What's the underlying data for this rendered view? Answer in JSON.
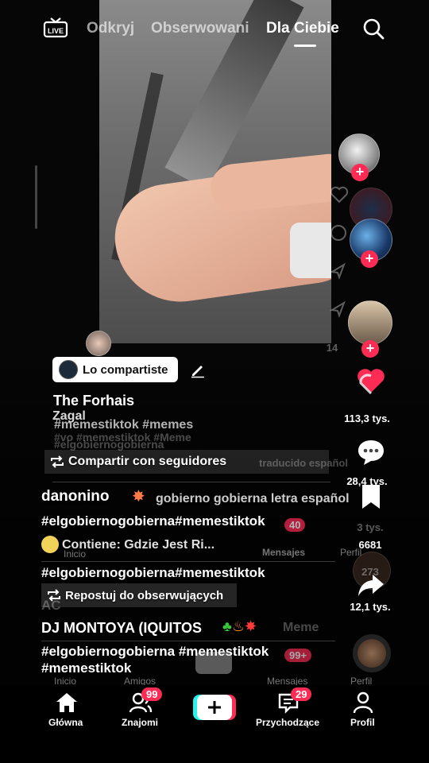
{
  "top_nav": {
    "live_label": "LIVE",
    "tabs": [
      {
        "label": "Odkryj",
        "active": false
      },
      {
        "label": "Obserwowani",
        "active": false
      },
      {
        "label": "Dla Ciebie",
        "active": true
      }
    ]
  },
  "overlay": {
    "shared_label": "Lo compartiste",
    "music_line": "The Forhais",
    "music_sub": "Zagal",
    "hashtags_1": "#memestiktok #memes",
    "ghost_hashtags": "#vo #memestiktok #Meme",
    "ghost_hashtag_2": "#elgobiernogobierna",
    "share_followers": "Compartir con seguidores",
    "ghost_translation": "traducido español",
    "username_1": "danonino",
    "caption_1": "gobierno gobierna letra español",
    "hashtags_2": "#elgobiernogobierna#memestiktok",
    "contains": "Contiene: Gdzie Jest Ri...",
    "ghost_inicio": "Inicio",
    "ghost_amigos": "Amigos",
    "ghost_mensajes": "Mensajes",
    "ghost_mensajes_badge": "40",
    "ghost_perfil": "Perfil",
    "hashtags_3": "#elgobiernogobierna#memestiktok",
    "repost_label": "Repostuj do obserwujących",
    "ghost_ac": "AC",
    "username_2": "DJ MONTOYA (IQUITOS",
    "ghost_meme": "Meme",
    "hashtags_4": "#elgobiernogobierna #memestiktok",
    "hashtags_5": "#memestiktok",
    "ghost_badge_99": "99+",
    "ghost_nav_2": [
      "Inicio",
      "Amigos",
      "Mensajes",
      "Perfil"
    ]
  },
  "right_rail": {
    "likes": "113,3 tys.",
    "comments": "28,4 tys.",
    "saves": "6681",
    "shares": "12,1 tys.",
    "ghost_saves": "3 tys.",
    "ghost_shares": "273",
    "ghost_likes": "14"
  },
  "bottom_nav": {
    "items": [
      {
        "label": "Główna",
        "icon": "home-icon"
      },
      {
        "label": "Znajomi",
        "icon": "friends-icon",
        "badge": "99"
      },
      {
        "label": "",
        "icon": "create-plus-icon"
      },
      {
        "label": "Przychodzące",
        "icon": "inbox-icon",
        "badge": "29"
      },
      {
        "label": "Profil",
        "icon": "profile-icon"
      }
    ]
  },
  "colors": {
    "accent": "#fe2c55",
    "cyan": "#25f4ee",
    "background": "#000000"
  }
}
